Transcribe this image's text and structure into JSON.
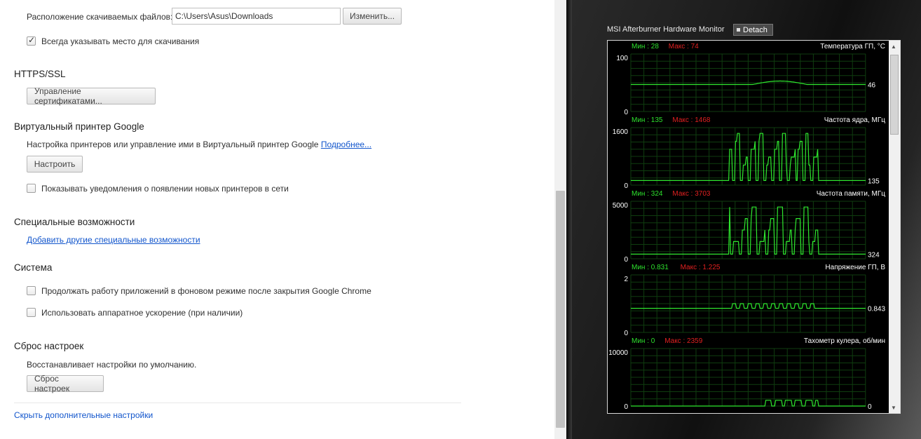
{
  "settings": {
    "downloads": {
      "location_label": "Расположение скачиваемых файлов:",
      "location_value": "C:\\Users\\Asus\\Downloads",
      "change_button": "Изменить...",
      "always_ask_label": "Всегда указывать место для скачивания",
      "always_ask_checked": true
    },
    "https": {
      "title": "HTTPS/SSL",
      "manage_certs_button": "Управление сертификатами..."
    },
    "cloud_print": {
      "title": "Виртуальный принтер Google",
      "description": "Настройка принтеров или управление ими в Виртуальный принтер Google",
      "more_link": "Подробнее...",
      "setup_button": "Настроить",
      "notify_label": "Показывать уведомления о появлении новых принтеров в сети",
      "notify_checked": false
    },
    "accessibility": {
      "title": "Специальные возможности",
      "add_link": "Добавить другие специальные возможности"
    },
    "system": {
      "title": "Система",
      "background_label": "Продолжать работу приложений в фоновом режиме после закрытия Google Chrome",
      "background_checked": false,
      "hwaccel_label": "Использовать аппаратное ускорение (при наличии)",
      "hwaccel_checked": false
    },
    "reset": {
      "title": "Сброс настроек",
      "description": "Восстанавливает настройки по умолчанию.",
      "reset_button": "Сброс настроек"
    },
    "hide_advanced_link": "Скрыть дополнительные настройки"
  },
  "afterburner": {
    "title": "MSI Afterburner Hardware Monitor",
    "detach_button": "Detach",
    "colors": {
      "line": "#2ee62e",
      "grid": "#0f3d0f",
      "min": "#2de02d",
      "max": "#e02020"
    },
    "graphs": [
      {
        "title": "Температура ГП, °C",
        "min": "Мин : 28",
        "max": "Макс : 74",
        "y_top": "100",
        "y_bottom": "0",
        "current": "46"
      },
      {
        "title": "Частота ядра, МГц",
        "min": "Мин : 135",
        "max": "Макс : 1468",
        "y_top": "1600",
        "y_bottom": "0",
        "current": "135"
      },
      {
        "title": "Частота памяти, МГц",
        "min": "Мин : 324",
        "max": "Макс : 3703",
        "y_top": "5000",
        "y_bottom": "0",
        "current": "324"
      },
      {
        "title": "Напряжение ГП, В",
        "min": "Мин : 0.831",
        "max": "Макс : 1.225",
        "y_top": "2",
        "y_bottom": "0",
        "current": "0.843"
      },
      {
        "title": "Тахометр кулера, об/мин",
        "min": "Мин : 0",
        "max": "Макс : 2359",
        "y_top": "10000",
        "y_bottom": "0",
        "current": "0"
      }
    ]
  }
}
